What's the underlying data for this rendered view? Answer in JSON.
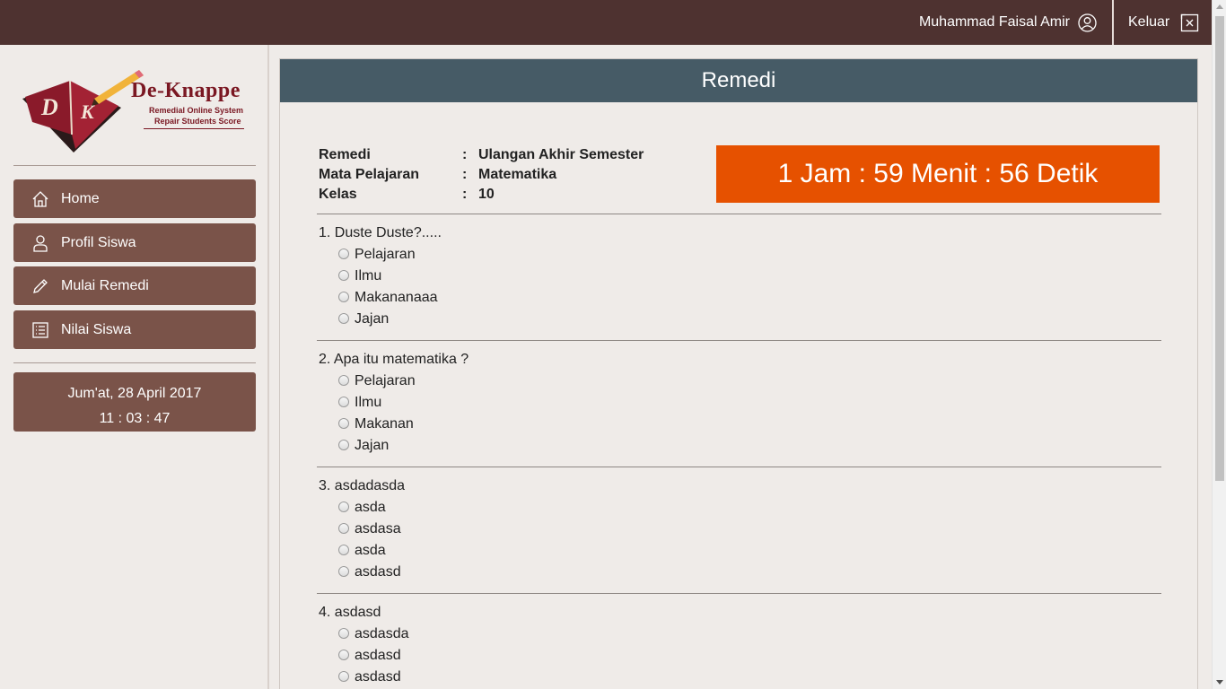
{
  "topbar": {
    "user_name": "Muhammad Faisal Amir",
    "logout_label": "Keluar"
  },
  "logo": {
    "brand": "De-Knappe",
    "tagline1": "Remedial Online System",
    "tagline2": "Repair Students Score"
  },
  "menu": [
    {
      "label": "Home",
      "icon": "home-icon"
    },
    {
      "label": "Profil Siswa",
      "icon": "user-icon"
    },
    {
      "label": "Mulai Remedi",
      "icon": "pencil-icon"
    },
    {
      "label": "Nilai Siswa",
      "icon": "list-icon"
    }
  ],
  "clock": {
    "date": "Jum'at, 28 April 2017",
    "time": "11 : 03 : 47"
  },
  "panel": {
    "title": "Remedi"
  },
  "info": [
    {
      "label": "Remedi",
      "value": "Ulangan Akhir Semester"
    },
    {
      "label": "Mata Pelajaran",
      "value": "Matematika"
    },
    {
      "label": "Kelas",
      "value": "10"
    }
  ],
  "separator": ":",
  "timer": "1 Jam : 59 Menit : 56 Detik",
  "questions": [
    {
      "text": "1. Duste Duste?.....",
      "options": [
        "Pelajaran",
        "Ilmu",
        "Makananaaa",
        "Jajan"
      ]
    },
    {
      "text": "2. Apa itu matematika ?",
      "options": [
        "Pelajaran",
        "Ilmu",
        "Makanan",
        "Jajan"
      ]
    },
    {
      "text": "3. asdadasda",
      "options": [
        "asda",
        "asdasa",
        "asda",
        "asdasd"
      ]
    },
    {
      "text": "4. asdasd",
      "options": [
        "asdasda",
        "asdasd",
        "asdasd"
      ]
    }
  ],
  "colors": {
    "topbar": "#4e3230",
    "menu": "#7a5349",
    "panel_header": "#465b66",
    "timer": "#e65100"
  }
}
